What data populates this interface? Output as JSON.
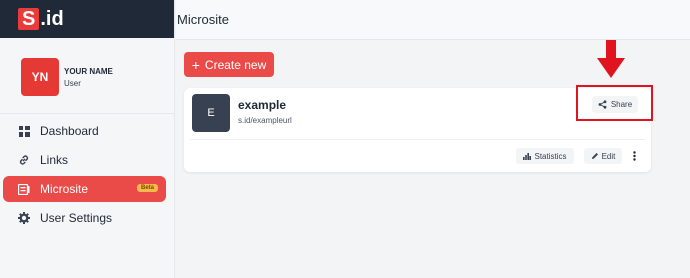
{
  "logo": {
    "mark": "S",
    "rest": ".id"
  },
  "profile": {
    "initials": "YN",
    "name": "YOUR NAME",
    "role": "User"
  },
  "nav": {
    "items": [
      {
        "label": "Dashboard",
        "icon": "dashboard-icon"
      },
      {
        "label": "Links",
        "icon": "link-icon"
      },
      {
        "label": "Microsite",
        "icon": "microsite-icon",
        "badge": "Beta",
        "active": true
      },
      {
        "label": "User Settings",
        "icon": "gear-icon"
      }
    ]
  },
  "header": {
    "title": "Microsite"
  },
  "main": {
    "create_label": "Create new",
    "card": {
      "initial": "E",
      "title": "example",
      "url": "s.id/exampleurl",
      "share_label": "Share",
      "statistics_label": "Statistics",
      "edit_label": "Edit"
    }
  },
  "colors": {
    "brand_red": "#ea4a48",
    "sidebar_header": "#1f2937",
    "annotation_red": "#e0141e",
    "beta_badge": "#f6b94a"
  }
}
